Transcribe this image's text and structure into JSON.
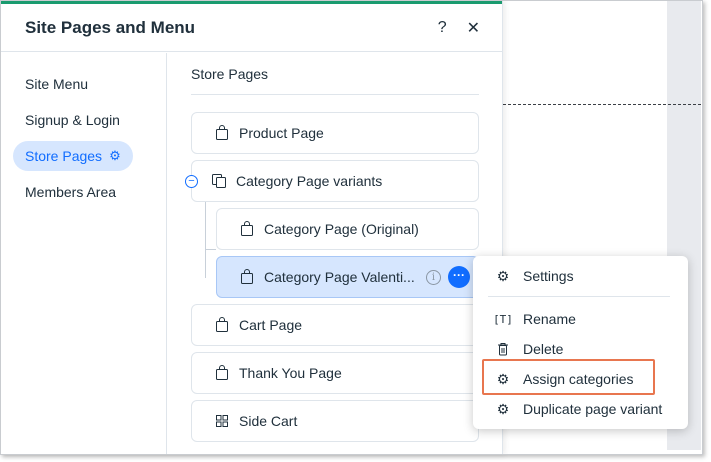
{
  "panel": {
    "title": "Site Pages and Menu",
    "help_label": "?",
    "close_label": "✕"
  },
  "sidebar": {
    "items": [
      {
        "label": "Site Menu"
      },
      {
        "label": "Signup & Login"
      },
      {
        "label": "Store Pages",
        "active": true
      },
      {
        "label": "Members Area"
      }
    ]
  },
  "main": {
    "section_title": "Store Pages",
    "pages": [
      {
        "label": "Product Page",
        "icon": "shopping-bag-icon"
      },
      {
        "label": "Category Page variants",
        "icon": "copy-pages-icon"
      },
      {
        "label": "Category Page (Original)",
        "icon": "shopping-bag-icon"
      },
      {
        "label": "Category Page Valenti...",
        "icon": "shopping-bag-icon",
        "selected": true
      },
      {
        "label": "Cart Page",
        "icon": "shopping-bag-icon"
      },
      {
        "label": "Thank You Page",
        "icon": "shopping-bag-icon"
      },
      {
        "label": "Side Cart",
        "icon": "grid-icon"
      }
    ]
  },
  "context_menu": {
    "items": [
      {
        "label": "Settings",
        "icon": "gear-icon"
      },
      {
        "label": "Rename",
        "icon": "rename-icon"
      },
      {
        "label": "Delete",
        "icon": "trash-icon"
      },
      {
        "label": "Assign categories",
        "icon": "gear-icon"
      },
      {
        "label": "Duplicate page variant",
        "icon": "gear-icon"
      }
    ]
  },
  "colors": {
    "accent": "#116dff",
    "top_bar": "#1a9b6f",
    "selected_bg": "#d6e6fe",
    "highlight_border": "#e8764f"
  }
}
